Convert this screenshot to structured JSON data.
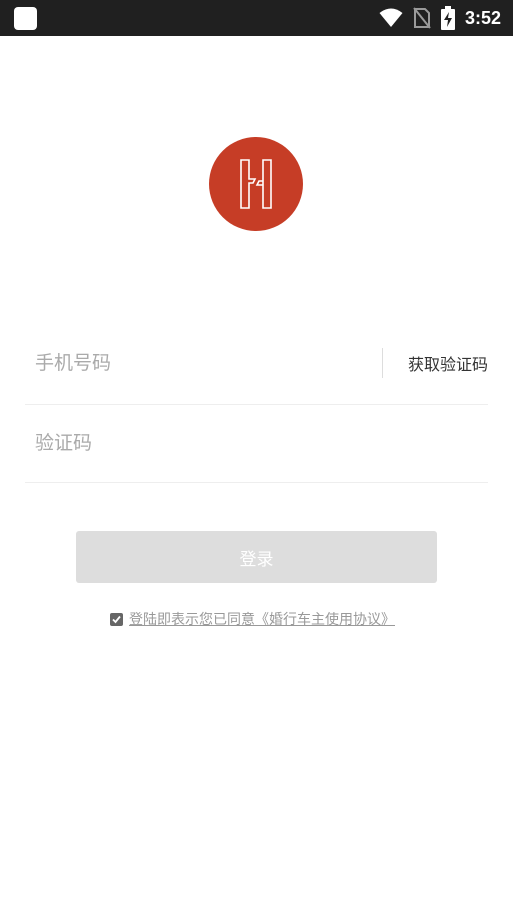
{
  "status_bar": {
    "time": "3:52",
    "icons": [
      "app-notification-icon",
      "wifi-icon",
      "no-sim-icon",
      "battery-charging-icon"
    ]
  },
  "logo": {
    "icon": "app-logo-icon",
    "color": "#c63d26"
  },
  "form": {
    "phone_placeholder": "手机号码",
    "get_code_label": "获取验证码",
    "code_placeholder": "验证码",
    "login_label": "登录",
    "login_button_color": "#dddddd"
  },
  "agreement": {
    "checked": true,
    "text": "登陆即表示您已同意《婚行车主使用协议》"
  }
}
